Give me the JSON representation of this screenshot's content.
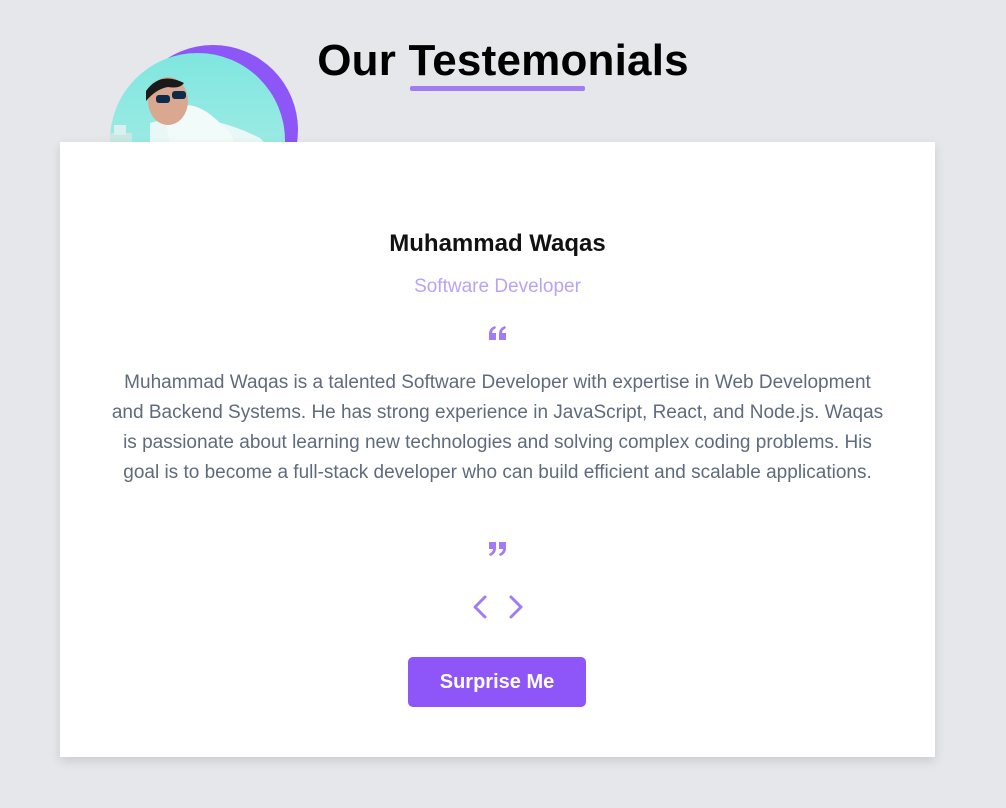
{
  "header": {
    "title": "Our Testemonials"
  },
  "testimonial": {
    "name": "Muhammad Waqas",
    "role": "Software Developer",
    "text": "Muhammad Waqas is a talented Software Developer with expertise in Web Development and Backend Systems. He has strong experience in JavaScript, React, and Node.js. Waqas is passionate about learning new technologies and solving complex coding problems. His goal is to become a full-stack developer who can build efficient and scalable applications.",
    "avatar_icon": "profile-photo"
  },
  "controls": {
    "prev_icon": "chevron-left-icon",
    "next_icon": "chevron-right-icon",
    "surprise_label": "Surprise Me"
  },
  "colors": {
    "accent": "#8e55f8",
    "accent_light": "#a27cf3",
    "role_text": "#b9a3f5",
    "body_text": "#5f6b7c",
    "background": "#e5e7eb",
    "card": "#ffffff"
  }
}
